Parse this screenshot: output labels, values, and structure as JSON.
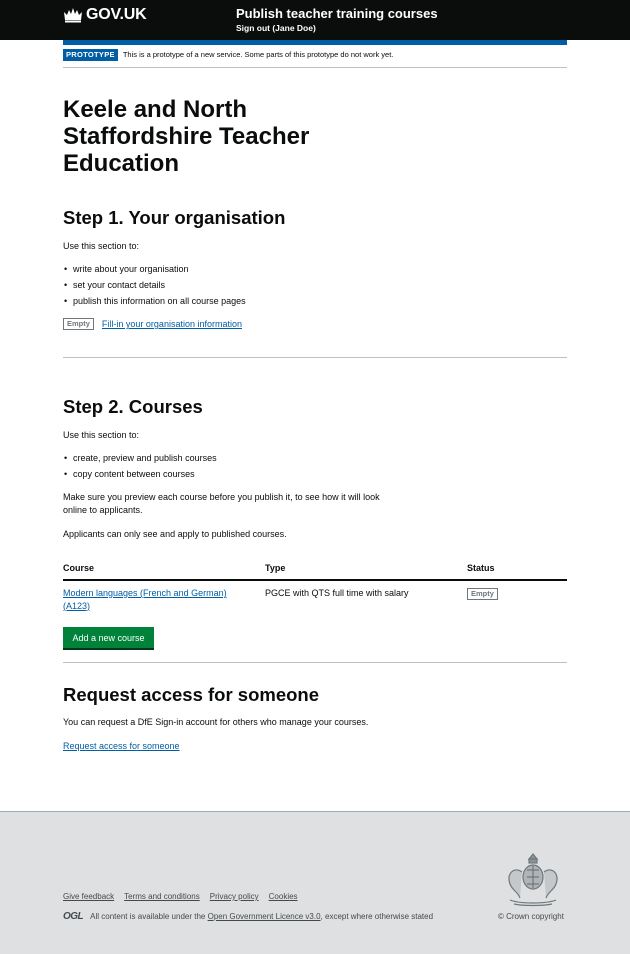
{
  "header": {
    "logo_text": "GOV.UK",
    "service_name": "Publish teacher training courses",
    "signout": "Sign out (Jane Doe)"
  },
  "phase": {
    "tag": "PROTOTYPE",
    "text": "This is a prototype of a new service. Some parts of this prototype do not work yet."
  },
  "page_title": "Keele and North Staffordshire Teacher Education",
  "step1": {
    "heading": "Step 1. Your organisation",
    "intro": "Use this section to:",
    "bullets": [
      "write about your organisation",
      "set your contact details",
      "publish this information on all course pages"
    ],
    "status_tag": "Empty",
    "link": "Fill-in your organisation information"
  },
  "step2": {
    "heading": "Step 2. Courses",
    "intro": "Use this section to:",
    "bullets": [
      "create, preview and publish courses",
      "copy content between courses"
    ],
    "para1": "Make sure you preview each course before you publish it, to see how it will look online to applicants.",
    "para2": "Applicants can only see and apply to published courses.",
    "table": {
      "headers": [
        "Course",
        "Type",
        "Status"
      ],
      "rows": [
        {
          "course": "Modern languages (French and German) (A123)",
          "type": "PGCE with QTS full time with salary",
          "status": "Empty"
        }
      ]
    },
    "add_button": "Add a new course"
  },
  "request": {
    "heading": "Request access for someone",
    "text": "You can request a DfE Sign-in account for others who manage your courses.",
    "link": "Request access for someone"
  },
  "footer": {
    "links": [
      "Give feedback",
      "Terms and conditions",
      "Privacy policy",
      "Cookies"
    ],
    "ogl_logo": "OGL",
    "licence_prefix": "All content is available under the",
    "licence_link": "Open Government Licence v3.0",
    "licence_suffix": ", except where otherwise stated",
    "copyright": "© Crown copyright"
  },
  "colors": {
    "header_bg": "#0b0c0c",
    "brand_blue": "#005ea5",
    "button_green": "#00823b",
    "footer_bg": "#dee0e2"
  }
}
